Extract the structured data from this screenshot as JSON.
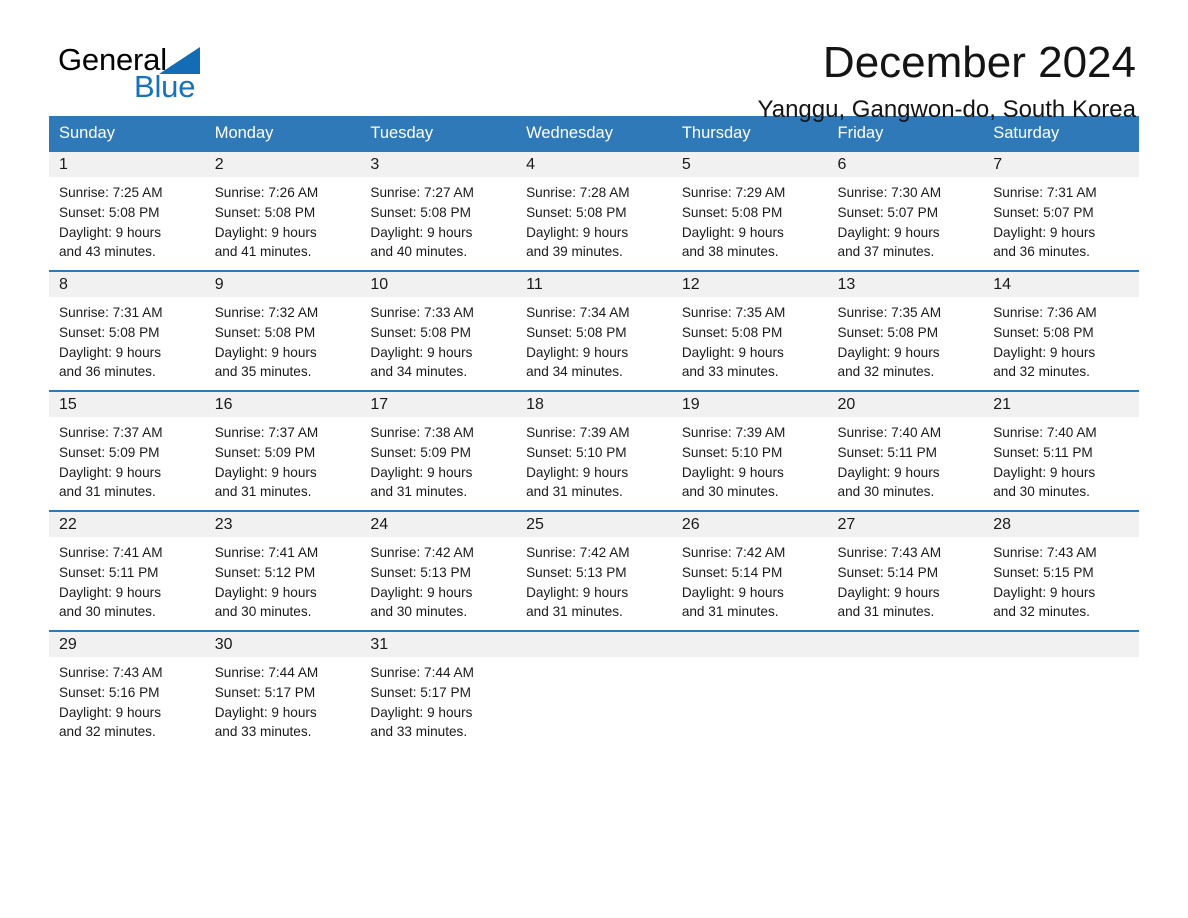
{
  "brand": {
    "name_part1": "General",
    "name_part2": "Blue",
    "flag_icon": "triangle-flag-icon",
    "accent_color": "#1572bb"
  },
  "header": {
    "title": "December 2024",
    "location": "Yanggu, Gangwon-do, South Korea",
    "header_bg_color": "#3079b8"
  },
  "calendar": {
    "weekday_headers": [
      "Sunday",
      "Monday",
      "Tuesday",
      "Wednesday",
      "Thursday",
      "Friday",
      "Saturday"
    ],
    "weeks": [
      [
        {
          "day": "1",
          "sunrise": "Sunrise: 7:25 AM",
          "sunset": "Sunset: 5:08 PM",
          "daylight_line1": "Daylight: 9 hours",
          "daylight_line2": "and 43 minutes."
        },
        {
          "day": "2",
          "sunrise": "Sunrise: 7:26 AM",
          "sunset": "Sunset: 5:08 PM",
          "daylight_line1": "Daylight: 9 hours",
          "daylight_line2": "and 41 minutes."
        },
        {
          "day": "3",
          "sunrise": "Sunrise: 7:27 AM",
          "sunset": "Sunset: 5:08 PM",
          "daylight_line1": "Daylight: 9 hours",
          "daylight_line2": "and 40 minutes."
        },
        {
          "day": "4",
          "sunrise": "Sunrise: 7:28 AM",
          "sunset": "Sunset: 5:08 PM",
          "daylight_line1": "Daylight: 9 hours",
          "daylight_line2": "and 39 minutes."
        },
        {
          "day": "5",
          "sunrise": "Sunrise: 7:29 AM",
          "sunset": "Sunset: 5:08 PM",
          "daylight_line1": "Daylight: 9 hours",
          "daylight_line2": "and 38 minutes."
        },
        {
          "day": "6",
          "sunrise": "Sunrise: 7:30 AM",
          "sunset": "Sunset: 5:07 PM",
          "daylight_line1": "Daylight: 9 hours",
          "daylight_line2": "and 37 minutes."
        },
        {
          "day": "7",
          "sunrise": "Sunrise: 7:31 AM",
          "sunset": "Sunset: 5:07 PM",
          "daylight_line1": "Daylight: 9 hours",
          "daylight_line2": "and 36 minutes."
        }
      ],
      [
        {
          "day": "8",
          "sunrise": "Sunrise: 7:31 AM",
          "sunset": "Sunset: 5:08 PM",
          "daylight_line1": "Daylight: 9 hours",
          "daylight_line2": "and 36 minutes."
        },
        {
          "day": "9",
          "sunrise": "Sunrise: 7:32 AM",
          "sunset": "Sunset: 5:08 PM",
          "daylight_line1": "Daylight: 9 hours",
          "daylight_line2": "and 35 minutes."
        },
        {
          "day": "10",
          "sunrise": "Sunrise: 7:33 AM",
          "sunset": "Sunset: 5:08 PM",
          "daylight_line1": "Daylight: 9 hours",
          "daylight_line2": "and 34 minutes."
        },
        {
          "day": "11",
          "sunrise": "Sunrise: 7:34 AM",
          "sunset": "Sunset: 5:08 PM",
          "daylight_line1": "Daylight: 9 hours",
          "daylight_line2": "and 34 minutes."
        },
        {
          "day": "12",
          "sunrise": "Sunrise: 7:35 AM",
          "sunset": "Sunset: 5:08 PM",
          "daylight_line1": "Daylight: 9 hours",
          "daylight_line2": "and 33 minutes."
        },
        {
          "day": "13",
          "sunrise": "Sunrise: 7:35 AM",
          "sunset": "Sunset: 5:08 PM",
          "daylight_line1": "Daylight: 9 hours",
          "daylight_line2": "and 32 minutes."
        },
        {
          "day": "14",
          "sunrise": "Sunrise: 7:36 AM",
          "sunset": "Sunset: 5:08 PM",
          "daylight_line1": "Daylight: 9 hours",
          "daylight_line2": "and 32 minutes."
        }
      ],
      [
        {
          "day": "15",
          "sunrise": "Sunrise: 7:37 AM",
          "sunset": "Sunset: 5:09 PM",
          "daylight_line1": "Daylight: 9 hours",
          "daylight_line2": "and 31 minutes."
        },
        {
          "day": "16",
          "sunrise": "Sunrise: 7:37 AM",
          "sunset": "Sunset: 5:09 PM",
          "daylight_line1": "Daylight: 9 hours",
          "daylight_line2": "and 31 minutes."
        },
        {
          "day": "17",
          "sunrise": "Sunrise: 7:38 AM",
          "sunset": "Sunset: 5:09 PM",
          "daylight_line1": "Daylight: 9 hours",
          "daylight_line2": "and 31 minutes."
        },
        {
          "day": "18",
          "sunrise": "Sunrise: 7:39 AM",
          "sunset": "Sunset: 5:10 PM",
          "daylight_line1": "Daylight: 9 hours",
          "daylight_line2": "and 31 minutes."
        },
        {
          "day": "19",
          "sunrise": "Sunrise: 7:39 AM",
          "sunset": "Sunset: 5:10 PM",
          "daylight_line1": "Daylight: 9 hours",
          "daylight_line2": "and 30 minutes."
        },
        {
          "day": "20",
          "sunrise": "Sunrise: 7:40 AM",
          "sunset": "Sunset: 5:11 PM",
          "daylight_line1": "Daylight: 9 hours",
          "daylight_line2": "and 30 minutes."
        },
        {
          "day": "21",
          "sunrise": "Sunrise: 7:40 AM",
          "sunset": "Sunset: 5:11 PM",
          "daylight_line1": "Daylight: 9 hours",
          "daylight_line2": "and 30 minutes."
        }
      ],
      [
        {
          "day": "22",
          "sunrise": "Sunrise: 7:41 AM",
          "sunset": "Sunset: 5:11 PM",
          "daylight_line1": "Daylight: 9 hours",
          "daylight_line2": "and 30 minutes."
        },
        {
          "day": "23",
          "sunrise": "Sunrise: 7:41 AM",
          "sunset": "Sunset: 5:12 PM",
          "daylight_line1": "Daylight: 9 hours",
          "daylight_line2": "and 30 minutes."
        },
        {
          "day": "24",
          "sunrise": "Sunrise: 7:42 AM",
          "sunset": "Sunset: 5:13 PM",
          "daylight_line1": "Daylight: 9 hours",
          "daylight_line2": "and 30 minutes."
        },
        {
          "day": "25",
          "sunrise": "Sunrise: 7:42 AM",
          "sunset": "Sunset: 5:13 PM",
          "daylight_line1": "Daylight: 9 hours",
          "daylight_line2": "and 31 minutes."
        },
        {
          "day": "26",
          "sunrise": "Sunrise: 7:42 AM",
          "sunset": "Sunset: 5:14 PM",
          "daylight_line1": "Daylight: 9 hours",
          "daylight_line2": "and 31 minutes."
        },
        {
          "day": "27",
          "sunrise": "Sunrise: 7:43 AM",
          "sunset": "Sunset: 5:14 PM",
          "daylight_line1": "Daylight: 9 hours",
          "daylight_line2": "and 31 minutes."
        },
        {
          "day": "28",
          "sunrise": "Sunrise: 7:43 AM",
          "sunset": "Sunset: 5:15 PM",
          "daylight_line1": "Daylight: 9 hours",
          "daylight_line2": "and 32 minutes."
        }
      ],
      [
        {
          "day": "29",
          "sunrise": "Sunrise: 7:43 AM",
          "sunset": "Sunset: 5:16 PM",
          "daylight_line1": "Daylight: 9 hours",
          "daylight_line2": "and 32 minutes."
        },
        {
          "day": "30",
          "sunrise": "Sunrise: 7:44 AM",
          "sunset": "Sunset: 5:17 PM",
          "daylight_line1": "Daylight: 9 hours",
          "daylight_line2": "and 33 minutes."
        },
        {
          "day": "31",
          "sunrise": "Sunrise: 7:44 AM",
          "sunset": "Sunset: 5:17 PM",
          "daylight_line1": "Daylight: 9 hours",
          "daylight_line2": "and 33 minutes."
        },
        {
          "day": "",
          "sunrise": "",
          "sunset": "",
          "daylight_line1": "",
          "daylight_line2": ""
        },
        {
          "day": "",
          "sunrise": "",
          "sunset": "",
          "daylight_line1": "",
          "daylight_line2": ""
        },
        {
          "day": "",
          "sunrise": "",
          "sunset": "",
          "daylight_line1": "",
          "daylight_line2": ""
        },
        {
          "day": "",
          "sunrise": "",
          "sunset": "",
          "daylight_line1": "",
          "daylight_line2": ""
        }
      ]
    ]
  }
}
